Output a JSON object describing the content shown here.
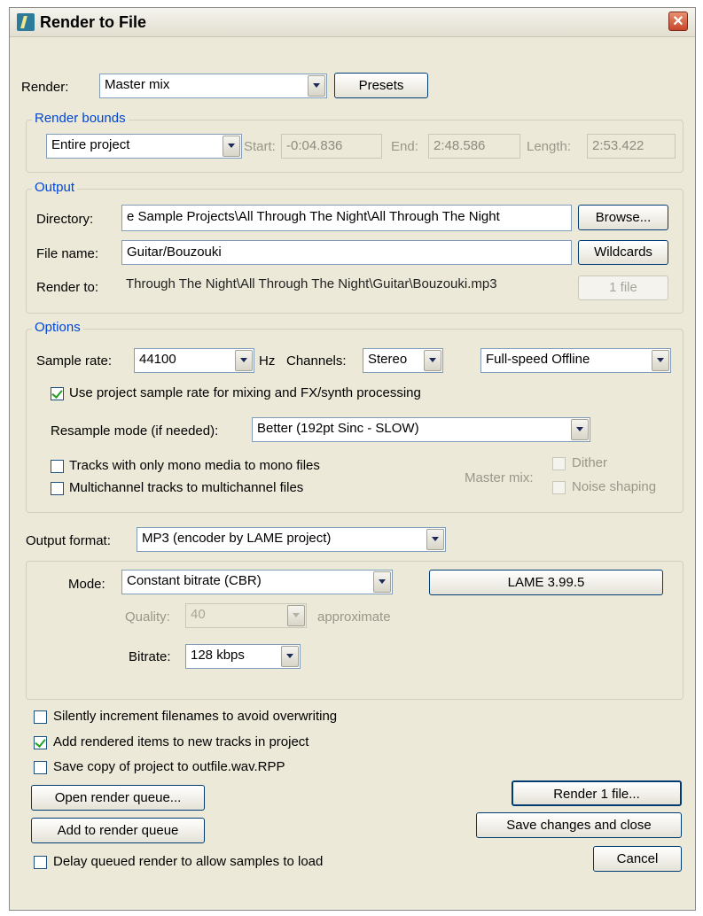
{
  "window": {
    "title": "Render to File",
    "close_glyph": "✕"
  },
  "render": {
    "label": "Render:",
    "value": "Master mix",
    "presets_label": "Presets"
  },
  "bounds": {
    "group_title": "Render bounds",
    "value": "Entire project",
    "start_label": "Start:",
    "start_value": "-0:04.836",
    "end_label": "End:",
    "end_value": "2:48.586",
    "length_label": "Length:",
    "length_value": "2:53.422"
  },
  "output": {
    "group_title": "Output",
    "directory_label": "Directory:",
    "directory_value": "e Sample Projects\\All Through The Night\\All Through The Night",
    "browse_label": "Browse...",
    "filename_label": "File name:",
    "filename_value": "Guitar/Bouzouki",
    "wildcards_label": "Wildcards",
    "renderto_label": "Render to:",
    "renderto_value": "Through The Night\\All Through The Night\\Guitar\\Bouzouki.mp3",
    "file_count_label": "1 file"
  },
  "options": {
    "group_title": "Options",
    "samplerate_label": "Sample rate:",
    "samplerate_value": "44100",
    "hz_label": "Hz",
    "channels_label": "Channels:",
    "channels_value": "Stereo",
    "speed_value": "Full-speed Offline",
    "use_project_rate_label": "Use project sample rate for mixing and FX/synth processing",
    "use_project_rate_checked": true,
    "resample_label": "Resample mode (if needed):",
    "resample_value": "Better (192pt Sinc - SLOW)",
    "mono_label": "Tracks with only mono media to mono files",
    "mono_checked": false,
    "multichannel_label": "Multichannel tracks to multichannel files",
    "multichannel_checked": false,
    "mastermix_label": "Master mix:",
    "dither_label": "Dither",
    "noise_label": "Noise shaping"
  },
  "format": {
    "label": "Output format:",
    "value": "MP3 (encoder by LAME project)"
  },
  "mp3": {
    "mode_label": "Mode:",
    "mode_value": "Constant bitrate  (CBR)",
    "lame_label": "LAME 3.99.5",
    "quality_label": "Quality:",
    "quality_value": "40",
    "approx_label": "approximate",
    "bitrate_label": "Bitrate:",
    "bitrate_value": "128 kbps"
  },
  "misc": {
    "silent_label": "Silently increment filenames to avoid overwriting",
    "silent_checked": false,
    "add_tracks_label": "Add rendered items to new tracks in project",
    "add_tracks_checked": true,
    "save_copy_label": "Save copy of project to outfile.wav.RPP",
    "save_copy_checked": false,
    "delay_label": "Delay queued render to allow samples to load",
    "delay_checked": false
  },
  "buttons": {
    "open_queue": "Open render queue...",
    "add_queue": "Add to render queue",
    "render": "Render 1 file...",
    "save_close": "Save changes and close",
    "cancel": "Cancel"
  }
}
